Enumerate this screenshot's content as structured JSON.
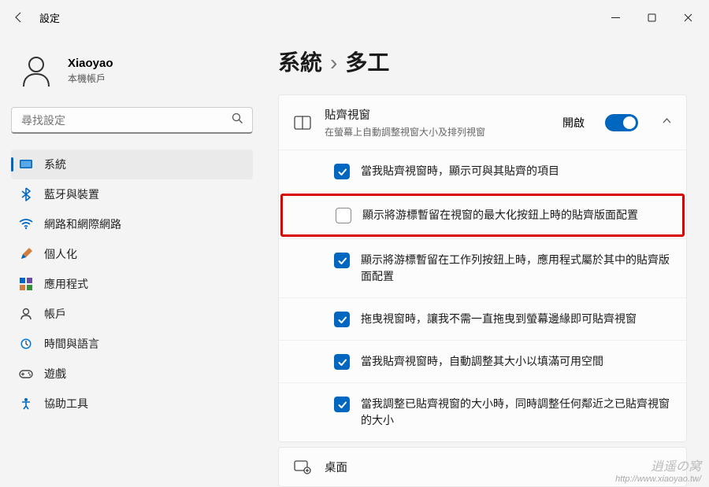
{
  "app_title": "設定",
  "profile": {
    "name": "Xiaoyao",
    "account_type": "本機帳戶"
  },
  "search": {
    "placeholder": "尋找設定"
  },
  "nav": {
    "items": [
      {
        "label": "系統",
        "icon": "system",
        "active": true
      },
      {
        "label": "藍牙與裝置",
        "icon": "bluetooth"
      },
      {
        "label": "網路和網際網路",
        "icon": "network"
      },
      {
        "label": "個人化",
        "icon": "personalize"
      },
      {
        "label": "應用程式",
        "icon": "apps"
      },
      {
        "label": "帳戶",
        "icon": "accounts"
      },
      {
        "label": "時間與語言",
        "icon": "time"
      },
      {
        "label": "遊戲",
        "icon": "gaming"
      },
      {
        "label": "協助工具",
        "icon": "accessibility"
      }
    ]
  },
  "breadcrumb": {
    "parent": "系統",
    "current": "多工"
  },
  "snap_card": {
    "title": "貼齊視窗",
    "subtitle": "在螢幕上自動調整視窗大小及排列視窗",
    "toggle_state": "開啟",
    "options": [
      {
        "checked": true,
        "highlighted": false,
        "text": "當我貼齊視窗時，顯示可與其貼齊的項目"
      },
      {
        "checked": false,
        "highlighted": true,
        "text": "顯示將游標暫留在視窗的最大化按鈕上時的貼齊版面配置"
      },
      {
        "checked": true,
        "highlighted": false,
        "text": "顯示將游標暫留在工作列按鈕上時，應用程式屬於其中的貼齊版面配置"
      },
      {
        "checked": true,
        "highlighted": false,
        "text": "拖曳視窗時，讓我不需一直拖曳到螢幕邊緣即可貼齊視窗"
      },
      {
        "checked": true,
        "highlighted": false,
        "text": "當我貼齊視窗時，自動調整其大小以填滿可用空間"
      },
      {
        "checked": true,
        "highlighted": false,
        "text": "當我調整已貼齊視窗的大小時，同時調整任何鄰近之已貼齊視窗的大小"
      }
    ]
  },
  "desktops_card": {
    "title": "桌面"
  },
  "watermark": {
    "brand": "逍遥の窝",
    "url": "http://www.xiaoyao.tw/"
  }
}
